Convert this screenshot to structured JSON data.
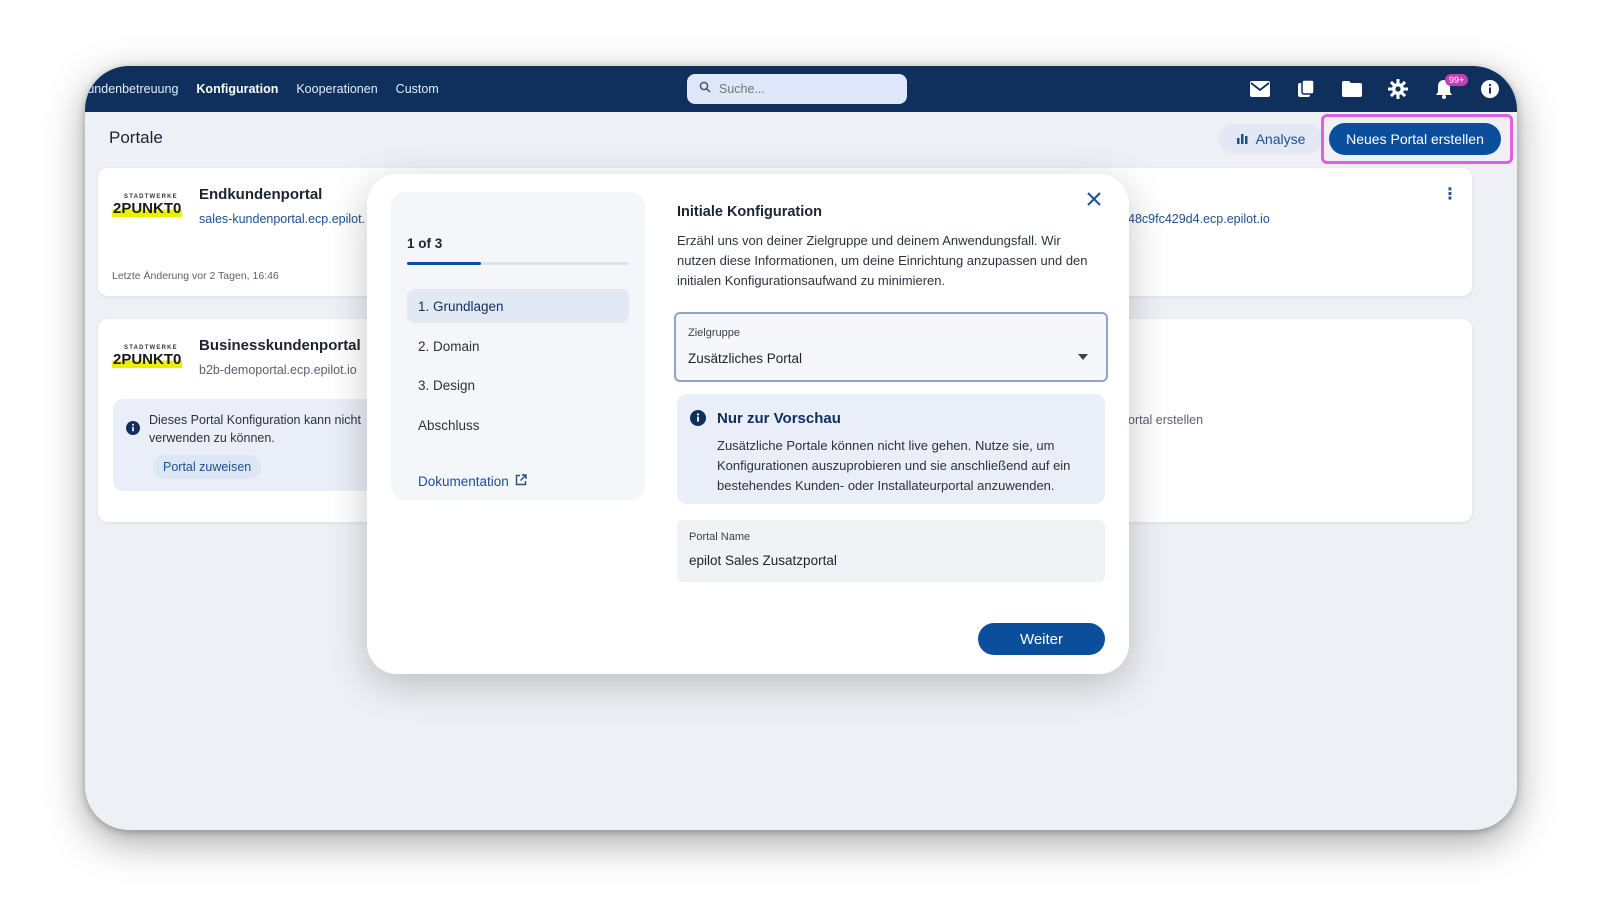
{
  "nav": {
    "items": [
      "Kundenbetreuung",
      "Konfiguration",
      "Kooperationen",
      "Custom"
    ],
    "active": "Konfiguration",
    "search_placeholder": "Suche...",
    "notification_count": "99+"
  },
  "page": {
    "title": "Portale",
    "analyse_label": "Analyse",
    "new_portal_label": "Neues Portal erstellen"
  },
  "cards": [
    {
      "logo_small": "STADTWERKE",
      "logo_big": "2PUNKT0",
      "title": "Endkundenportal",
      "url": "sales-kundenportal.ecp.epilot.",
      "url_right": "48c9fc429d4.ecp.epilot.io",
      "meta": "Letzte Änderung vor 2 Tagen, 16:46"
    },
    {
      "logo_small": "STADTWERKE",
      "logo_big": "2PUNKT0",
      "title": "Businesskundenportal",
      "url": "b2b-demoportal.ecp.epilot.io",
      "warning_line1": "Dieses Portal Konfiguration kann nicht",
      "warning_line2": "verwenden zu können.",
      "assign_label": "Portal zuweisen",
      "right_text": "ortal erstellen"
    }
  ],
  "modal": {
    "progress_label": "1 of 3",
    "progress_fraction": 0.333,
    "steps": [
      "1. Grundlagen",
      "2. Domain",
      "3. Design",
      "Abschluss"
    ],
    "active_step": 0,
    "doc_link": "Dokumentation",
    "title": "Initiale Konfiguration",
    "description": "Erzähl uns von deiner Zielgruppe und deinem Anwendungsfall. Wir nutzen diese Informationen, um deine Einrichtung anzupassen und den initialen Konfigurationsaufwand zu minimieren.",
    "target_label": "Zielgruppe",
    "target_value": "Zusätzliches Portal",
    "info_title": "Nur zur Vorschau",
    "info_text": "Zusätzliche Portale können nicht live gehen. Nutze sie, um Konfigurationen auszuprobieren und sie anschließend auf ein bestehendes Kunden- oder Installateurportal anzuwenden.",
    "name_label": "Portal Name",
    "name_value": "epilot Sales Zusatzportal",
    "next_label": "Weiter"
  },
  "colors": {
    "topbar": "#0f2f5c",
    "primary": "#0b4f9c",
    "highlight": "#e05ee0",
    "badge": "#c23fb6"
  }
}
